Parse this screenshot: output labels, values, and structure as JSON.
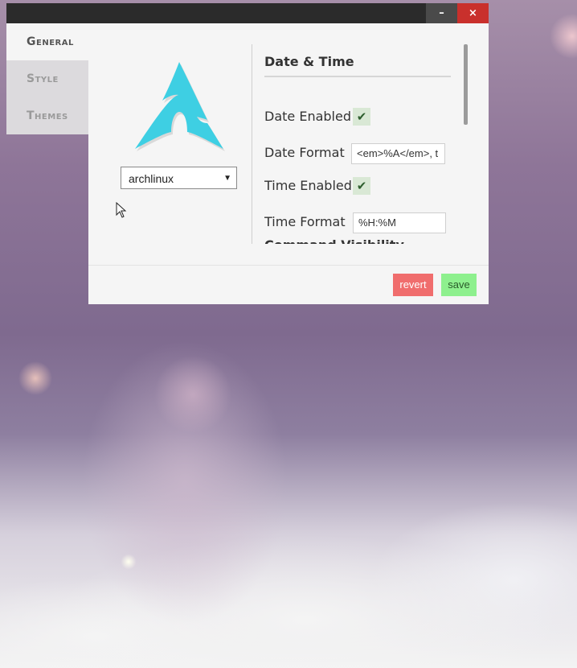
{
  "window": {
    "minimize_glyph": "–",
    "close_glyph": "×"
  },
  "sidebar": {
    "items": [
      {
        "label": "General",
        "active": true
      },
      {
        "label": "Style",
        "active": false
      },
      {
        "label": "Themes",
        "active": false
      }
    ]
  },
  "logo": {
    "icon": "arch-linux-logo-icon",
    "color": "#3ecfe3"
  },
  "theme_select": {
    "value": "archlinux",
    "caret": "▼"
  },
  "settings": {
    "section_title": "Date & Time",
    "date_enabled_label": "Date Enabled",
    "date_enabled_check": "✔",
    "date_format_label": "Date Format",
    "date_format_value": "<em>%A</em>, t",
    "time_enabled_label": "Time Enabled",
    "time_enabled_check": "✔",
    "time_format_label": "Time Format",
    "time_format_value": "%H:%M",
    "next_section_title": "Command Visibility"
  },
  "footer": {
    "revert_label": "revert",
    "save_label": "save"
  },
  "colors": {
    "revert": "#f06d6d",
    "save": "#8ef08e",
    "close": "#c9302c"
  }
}
